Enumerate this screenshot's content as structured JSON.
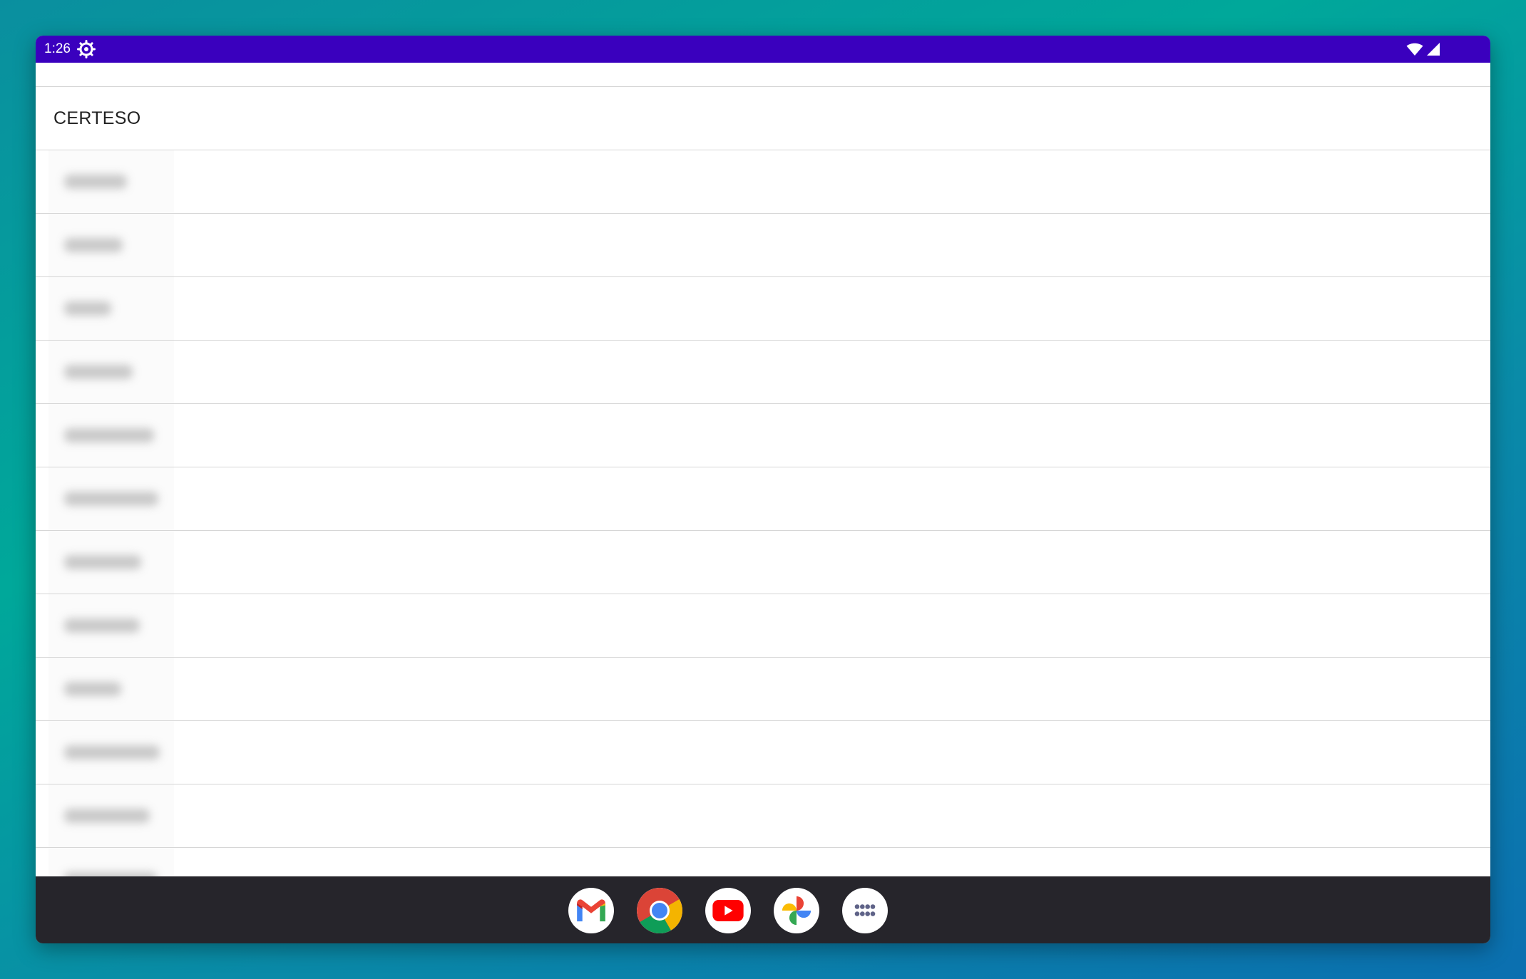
{
  "status_bar": {
    "time": "1:26",
    "icons": [
      "settings-gear-icon",
      "wifi-icon",
      "cell-signal-icon"
    ],
    "color": "#3a00be"
  },
  "app": {
    "header_title": "CERTESO",
    "rows_count_note": "",
    "rows": [
      {
        "label": ""
      },
      {
        "label": ""
      },
      {
        "label": ""
      },
      {
        "label": ""
      },
      {
        "label": ""
      },
      {
        "label": ""
      },
      {
        "label": ""
      },
      {
        "label": ""
      },
      {
        "label": ""
      },
      {
        "label": ""
      },
      {
        "label": ""
      },
      {
        "label": ""
      }
    ]
  },
  "dock": {
    "apps": [
      "gmail-icon",
      "chrome-icon",
      "youtube-icon",
      "google-photos-icon",
      "app-drawer-icon"
    ]
  }
}
